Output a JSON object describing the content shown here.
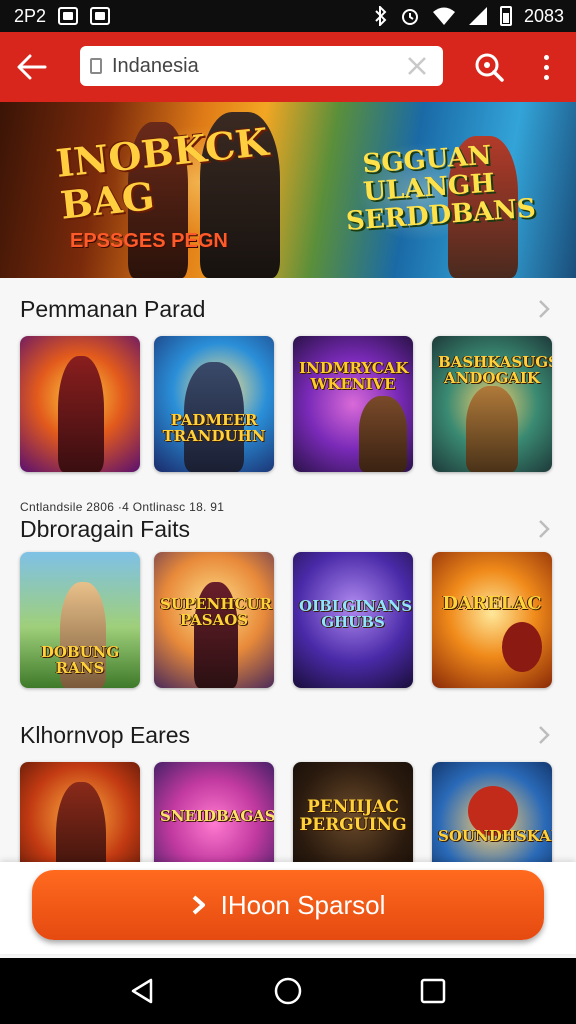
{
  "status_bar": {
    "left_text": "2P2",
    "right_text": "2083"
  },
  "search": {
    "value": "Indanesia",
    "placeholder": ""
  },
  "hero": {
    "left_title": "INOBKCK BAG",
    "left_tagline": "EPSSGES PEGN",
    "right_title": "SGGUAN ULANGH SERDDBANS"
  },
  "sections": [
    {
      "title": "Pemmanan Parad",
      "caption": "",
      "tiles": [
        "",
        "PADMEER TRANDUHN",
        "INDMRYCAK WKENIVE",
        "BASHKASUGS ANDOGAIK"
      ]
    },
    {
      "title": "Dbroragain Faits",
      "caption": "Cntlandsile 2806 ·4 Ontlinasc 18. 91",
      "tiles": [
        "DOBUNG RANS",
        "SUPENHCUR PASAOS",
        "OIBLGINANS GHUBS",
        "DARELAC"
      ]
    },
    {
      "title": "Klhornvop Eares",
      "caption": "",
      "tiles": [
        "",
        "SNEIDBAGAS",
        "PENIIJAC PERGUING",
        "SOUNDHSKANS"
      ]
    }
  ],
  "action": {
    "label": "IHoon Sparsol"
  },
  "colors": {
    "app_bar": "#d8261d",
    "action": "#f05a18"
  }
}
